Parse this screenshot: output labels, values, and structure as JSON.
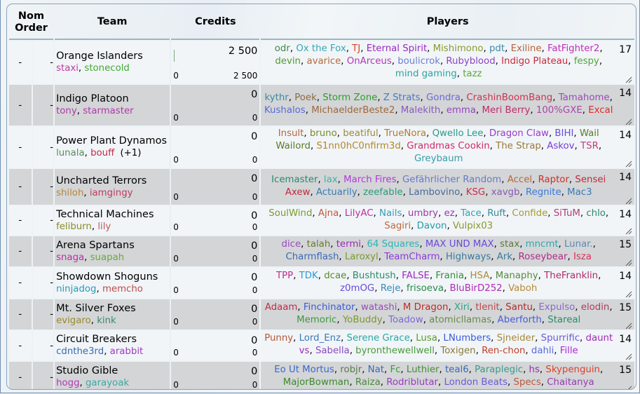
{
  "header": {
    "nom_order": "Nom Order",
    "nom_line1": "Nom",
    "nom_line2": "Order",
    "team": "Team",
    "credits": "Credits",
    "players": "Players"
  },
  "teams": [
    {
      "nom": "-",
      "order": "-",
      "name": "Orange Islanders",
      "managers": [
        {
          "n": "staxi",
          "c": "#c0399f"
        },
        {
          "n": "stonecold",
          "c": "#45a835"
        }
      ],
      "managers_extra": "",
      "credits": "2 500",
      "credits_spent": "0",
      "credits_left": "2 500",
      "count": "17",
      "players": [
        {
          "n": "odr",
          "c": "#3e8a4a"
        },
        {
          "n": "Ox the Fox",
          "c": "#3aa6b5"
        },
        {
          "n": "TJ",
          "c": "#d24b2a"
        },
        {
          "n": "Eternal Spirit",
          "c": "#9a2bc0"
        },
        {
          "n": "Mishimono",
          "c": "#8a9a2e"
        },
        {
          "n": "pdt",
          "c": "#3f8aa6"
        },
        {
          "n": "Exiline",
          "c": "#b5643a"
        },
        {
          "n": "FatFighter2",
          "c": "#c12fb8"
        },
        {
          "n": "devin",
          "c": "#4f9c2e"
        },
        {
          "n": "avarice",
          "c": "#b56b3a"
        },
        {
          "n": "OnArceus",
          "c": "#b236b5"
        },
        {
          "n": "boulicrok",
          "c": "#6f7fcf"
        },
        {
          "n": "Rubyblood",
          "c": "#8c44c2"
        },
        {
          "n": "Indigo Plateau",
          "c": "#c92b3a"
        },
        {
          "n": "fespy",
          "c": "#4fa63a"
        },
        {
          "n": "mind gaming",
          "c": "#2aa5a0"
        },
        {
          "n": "tazz",
          "c": "#5aa83a"
        }
      ]
    },
    {
      "nom": "-",
      "order": "-",
      "name": "Indigo Platoon",
      "managers": [
        {
          "n": "tony",
          "c": "#b03aa6"
        },
        {
          "n": "starmaster",
          "c": "#b03aa6"
        }
      ],
      "managers_extra": "",
      "credits": "0",
      "credits_spent": "0",
      "credits_left": "0",
      "count": "14",
      "players": [
        {
          "n": "kythr",
          "c": "#3a8aa0"
        },
        {
          "n": "Poek",
          "c": "#8a6a45"
        },
        {
          "n": "Storm Zone",
          "c": "#2f9c2f"
        },
        {
          "n": "Z Strats",
          "c": "#4a7ac0"
        },
        {
          "n": "Gondra",
          "c": "#6a6ad8"
        },
        {
          "n": "CrashinBoomBang",
          "c": "#d0304f"
        },
        {
          "n": "Tamahome",
          "c": "#9a4ab5"
        },
        {
          "n": "Kushalos",
          "c": "#5a6ad8"
        },
        {
          "n": "MichaelderBeste2",
          "c": "#a0673a"
        },
        {
          "n": "Malekith",
          "c": "#8a5ac0"
        },
        {
          "n": "emma",
          "c": "#9a44c0"
        },
        {
          "n": "Meri Berry",
          "c": "#c02a6a"
        },
        {
          "n": "100%GXE",
          "c": "#b044a8"
        },
        {
          "n": "Excal",
          "c": "#e02a2a"
        }
      ]
    },
    {
      "nom": "-",
      "order": "-",
      "name": "Power Plant Dynamos",
      "managers": [
        {
          "n": "lunala",
          "c": "#5a8a5a"
        },
        {
          "n": "bouff",
          "c": "#c02a4a"
        }
      ],
      "managers_extra": "(+1)",
      "credits": "0",
      "credits_spent": "0",
      "credits_left": "0",
      "count": "14",
      "players": [
        {
          "n": "Insult",
          "c": "#b5673a"
        },
        {
          "n": "bruno",
          "c": "#7a8a2a"
        },
        {
          "n": "beatiful",
          "c": "#9a8a3a"
        },
        {
          "n": "TrueNora",
          "c": "#b57a2a"
        },
        {
          "n": "Qwello Lee",
          "c": "#2a9a8a"
        },
        {
          "n": "Dragon Claw",
          "c": "#9a3ac8"
        },
        {
          "n": "BIHI",
          "c": "#6a4ad8"
        },
        {
          "n": "Wail Wailord",
          "c": "#5a7a2a"
        },
        {
          "n": "S1nn0hC0nfirm3d",
          "c": "#b5872a"
        },
        {
          "n": "Grandmas Cookin",
          "c": "#d02a6a"
        },
        {
          "n": "The Strap",
          "c": "#9a7a3a"
        },
        {
          "n": "Askov",
          "c": "#7a3ad8"
        },
        {
          "n": "TSR",
          "c": "#c83a7a"
        },
        {
          "n": "Greybaum",
          "c": "#3a9aa8"
        }
      ]
    },
    {
      "nom": "-",
      "order": "-",
      "name": "Uncharted Terrors",
      "managers": [
        {
          "n": "shiloh",
          "c": "#b5873a"
        },
        {
          "n": "iamgingy",
          "c": "#c03a5a"
        }
      ],
      "managers_extra": "",
      "credits": "0",
      "credits_spent": "0",
      "credits_left": "0",
      "count": "14",
      "players": [
        {
          "n": "Icemaster",
          "c": "#2a8a6a"
        },
        {
          "n": "lax",
          "c": "#3ab5a8"
        },
        {
          "n": "March Fires",
          "c": "#b03ad8"
        },
        {
          "n": "Gefährlicher Random",
          "c": "#6a7ac8"
        },
        {
          "n": "Accel",
          "c": "#b5673a"
        },
        {
          "n": "Raptor",
          "c": "#c8302a"
        },
        {
          "n": "Sensei Axew",
          "c": "#c02a3a"
        },
        {
          "n": "Actuarily",
          "c": "#3a7ab5"
        },
        {
          "n": "zeefable",
          "c": "#2a9a7a"
        },
        {
          "n": "Lambovino",
          "c": "#4a6a9a"
        },
        {
          "n": "KSG",
          "c": "#d02a4a"
        },
        {
          "n": "xavgb",
          "c": "#8a5ab5"
        },
        {
          "n": "Regnite",
          "c": "#3a7ad8"
        },
        {
          "n": "Mac3",
          "c": "#3a7ab5"
        }
      ]
    },
    {
      "nom": "-",
      "order": "-",
      "name": "Technical Machines",
      "managers": [
        {
          "n": "feliburn",
          "c": "#8a8a2a"
        },
        {
          "n": "lily",
          "c": "#c05a5a"
        }
      ],
      "managers_extra": "",
      "credits": "0",
      "credits_spent": "0",
      "credits_left": "0",
      "count": "14",
      "players": [
        {
          "n": "SoulWind",
          "c": "#7a9a2a"
        },
        {
          "n": "Ajna",
          "c": "#c8573a"
        },
        {
          "n": "LilyAC",
          "c": "#c02aa8"
        },
        {
          "n": "Nails",
          "c": "#3a9ab5"
        },
        {
          "n": "umbry",
          "c": "#a03a9a"
        },
        {
          "n": "ez",
          "c": "#9a3ab5"
        },
        {
          "n": "Tace",
          "c": "#2aa8b5"
        },
        {
          "n": "Ruft",
          "c": "#3a8a9a"
        },
        {
          "n": "Confide",
          "c": "#a89a2a"
        },
        {
          "n": "SiTuM",
          "c": "#b53a7a"
        },
        {
          "n": "chlo",
          "c": "#2a8a6a"
        },
        {
          "n": "Sagiri",
          "c": "#c0673a"
        },
        {
          "n": "Davon",
          "c": "#2a9aa8"
        },
        {
          "n": "Vulpix03",
          "c": "#8a9a2a"
        }
      ]
    },
    {
      "nom": "-",
      "order": "-",
      "name": "Arena Spartans",
      "managers": [
        {
          "n": "snaga",
          "c": "#c02aa8"
        },
        {
          "n": "suapah",
          "c": "#6aa83a"
        }
      ],
      "managers_extra": "",
      "credits": "0",
      "credits_spent": "0",
      "credits_left": "0",
      "count": "15",
      "players": [
        {
          "n": "dice",
          "c": "#9a4ac0"
        },
        {
          "n": "talah",
          "c": "#6a7a2a"
        },
        {
          "n": "termi",
          "c": "#9a2ab5"
        },
        {
          "n": "64 Squares",
          "c": "#2ab5b5"
        },
        {
          "n": "MAX UND MAX",
          "c": "#6a4ad8"
        },
        {
          "n": "stax",
          "c": "#5a7a3a"
        },
        {
          "n": "mncmt",
          "c": "#2aa8b5"
        },
        {
          "n": "Lunar.",
          "c": "#5a8ab5"
        },
        {
          "n": "Charmflash",
          "c": "#3a6ab5"
        },
        {
          "n": "Laroxyl",
          "c": "#7a9a2a"
        },
        {
          "n": "TeamCharm",
          "c": "#8a3ad8"
        },
        {
          "n": "Highways",
          "c": "#3a7a9a"
        },
        {
          "n": "Ark",
          "c": "#3a7a9a"
        },
        {
          "n": "Roseybear",
          "c": "#b02a8a"
        },
        {
          "n": "Isza",
          "c": "#e02a5a"
        }
      ]
    },
    {
      "nom": "-",
      "order": "-",
      "name": "Showdown Shoguns",
      "managers": [
        {
          "n": "ninjadog",
          "c": "#2a9ab5"
        },
        {
          "n": "memcho",
          "c": "#c04a4a"
        }
      ],
      "managers_extra": "",
      "credits": "0",
      "credits_spent": "0",
      "credits_left": "0",
      "count": "14",
      "players": [
        {
          "n": "TPP",
          "c": "#c02a8a"
        },
        {
          "n": "TDK",
          "c": "#2a9ad8"
        },
        {
          "n": "dcae",
          "c": "#5a8a2a"
        },
        {
          "n": "Bushtush",
          "c": "#2a8a6a"
        },
        {
          "n": "FALSE",
          "c": "#9a2ac0"
        },
        {
          "n": "Frania",
          "c": "#3a8a3a"
        },
        {
          "n": "HSA",
          "c": "#a88a3a"
        },
        {
          "n": "Manaphy",
          "c": "#5a8a3a"
        },
        {
          "n": "TheFranklin",
          "c": "#b02a6a"
        },
        {
          "n": "z0mOG",
          "c": "#6a4ad8"
        },
        {
          "n": "Reje",
          "c": "#3a8ab5"
        },
        {
          "n": "frisoeva",
          "c": "#2a8a4a"
        },
        {
          "n": "BluBirD252",
          "c": "#b02ab5"
        },
        {
          "n": "Vaboh",
          "c": "#b58a3a"
        }
      ]
    },
    {
      "nom": "-",
      "order": "-",
      "name": "Mt. Silver Foxes",
      "managers": [
        {
          "n": "evigaro",
          "c": "#9a8a2a"
        },
        {
          "n": "kink",
          "c": "#3a8a6a"
        }
      ],
      "managers_extra": "",
      "credits": "0",
      "credits_spent": "0",
      "credits_left": "0",
      "count": "15",
      "players": [
        {
          "n": "Adaam",
          "c": "#c02a4a"
        },
        {
          "n": "Finchinator",
          "c": "#3a5ad8"
        },
        {
          "n": "watashi",
          "c": "#9a4ab5"
        },
        {
          "n": "M Dragon",
          "c": "#c02a2a"
        },
        {
          "n": "Xiri",
          "c": "#2aa88a"
        },
        {
          "n": "tlenit",
          "c": "#c04a4a"
        },
        {
          "n": "Santu",
          "c": "#b02a2a"
        },
        {
          "n": "Expulso",
          "c": "#8a6ac8"
        },
        {
          "n": "elodin",
          "c": "#b03a5a"
        },
        {
          "n": "Memoric",
          "c": "#3a9a3a"
        },
        {
          "n": "YoBuddy",
          "c": "#7a9a2a"
        },
        {
          "n": "Toadow",
          "c": "#7a6ad8"
        },
        {
          "n": "atomicllamas",
          "c": "#6a8a4a"
        },
        {
          "n": "Aberforth",
          "c": "#4a5ad8"
        },
        {
          "n": "Stareal",
          "c": "#2a8a6a"
        }
      ]
    },
    {
      "nom": "-",
      "order": "-",
      "name": "Circuit Breakers",
      "managers": [
        {
          "n": "cdnthe3rd",
          "c": "#3a6ab5"
        },
        {
          "n": "arabbit",
          "c": "#a03ac0"
        }
      ],
      "managers_extra": "",
      "credits": "0",
      "credits_spent": "0",
      "credits_left": "0",
      "count": "14",
      "players": [
        {
          "n": "Punny",
          "c": "#b5573a"
        },
        {
          "n": "Lord_Enz",
          "c": "#3a7ab5"
        },
        {
          "n": "Serene Grace",
          "c": "#2aa8a0"
        },
        {
          "n": "Lusa",
          "c": "#5a9a2a"
        },
        {
          "n": "LNumbers",
          "c": "#3a5ad8"
        },
        {
          "n": "Sjneider",
          "c": "#a8873a"
        },
        {
          "n": "Spurrific",
          "c": "#6a5ad8"
        },
        {
          "n": "daunt vs",
          "c": "#a02ab5"
        },
        {
          "n": "Sabella",
          "c": "#8a4ac0"
        },
        {
          "n": "byronthewellwell",
          "c": "#4a9a3a"
        },
        {
          "n": "Toxigen",
          "c": "#8a7a3a"
        },
        {
          "n": "Ren-chon",
          "c": "#c0402a"
        },
        {
          "n": "dahli",
          "c": "#5a6ad8"
        },
        {
          "n": "Fille",
          "c": "#b02ad8"
        }
      ]
    },
    {
      "nom": "-",
      "order": "-",
      "name": "Studio Gible",
      "managers": [
        {
          "n": "hogg",
          "c": "#b03ab5"
        },
        {
          "n": "garayoak",
          "c": "#3aa8a0"
        }
      ],
      "managers_extra": "",
      "credits": "0",
      "credits_spent": "0",
      "credits_left": "0",
      "count": "15",
      "players": [
        {
          "n": "Eo Ut Mortus",
          "c": "#3a6ac8"
        },
        {
          "n": "robjr",
          "c": "#5a7a4a"
        },
        {
          "n": "Nat",
          "c": "#3a6ab5"
        },
        {
          "n": "Fc",
          "c": "#3a9a3a"
        },
        {
          "n": "Luthier",
          "c": "#4a8a3a"
        },
        {
          "n": "teal6",
          "c": "#3a6ab5"
        },
        {
          "n": "Paraplegic",
          "c": "#3a9a8a"
        },
        {
          "n": "hs",
          "c": "#9a2ab5"
        },
        {
          "n": "Skypenguin",
          "c": "#e0402a"
        },
        {
          "n": "MajorBowman",
          "c": "#3a8a2a"
        },
        {
          "n": "Raiza",
          "c": "#4a8a3a"
        },
        {
          "n": "Rodriblutar",
          "c": "#9a3ac0"
        },
        {
          "n": "London Beats",
          "c": "#6a5ad8"
        },
        {
          "n": "Specs",
          "c": "#c0573a"
        },
        {
          "n": "Chaitanya",
          "c": "#9a3ab5"
        }
      ]
    }
  ]
}
